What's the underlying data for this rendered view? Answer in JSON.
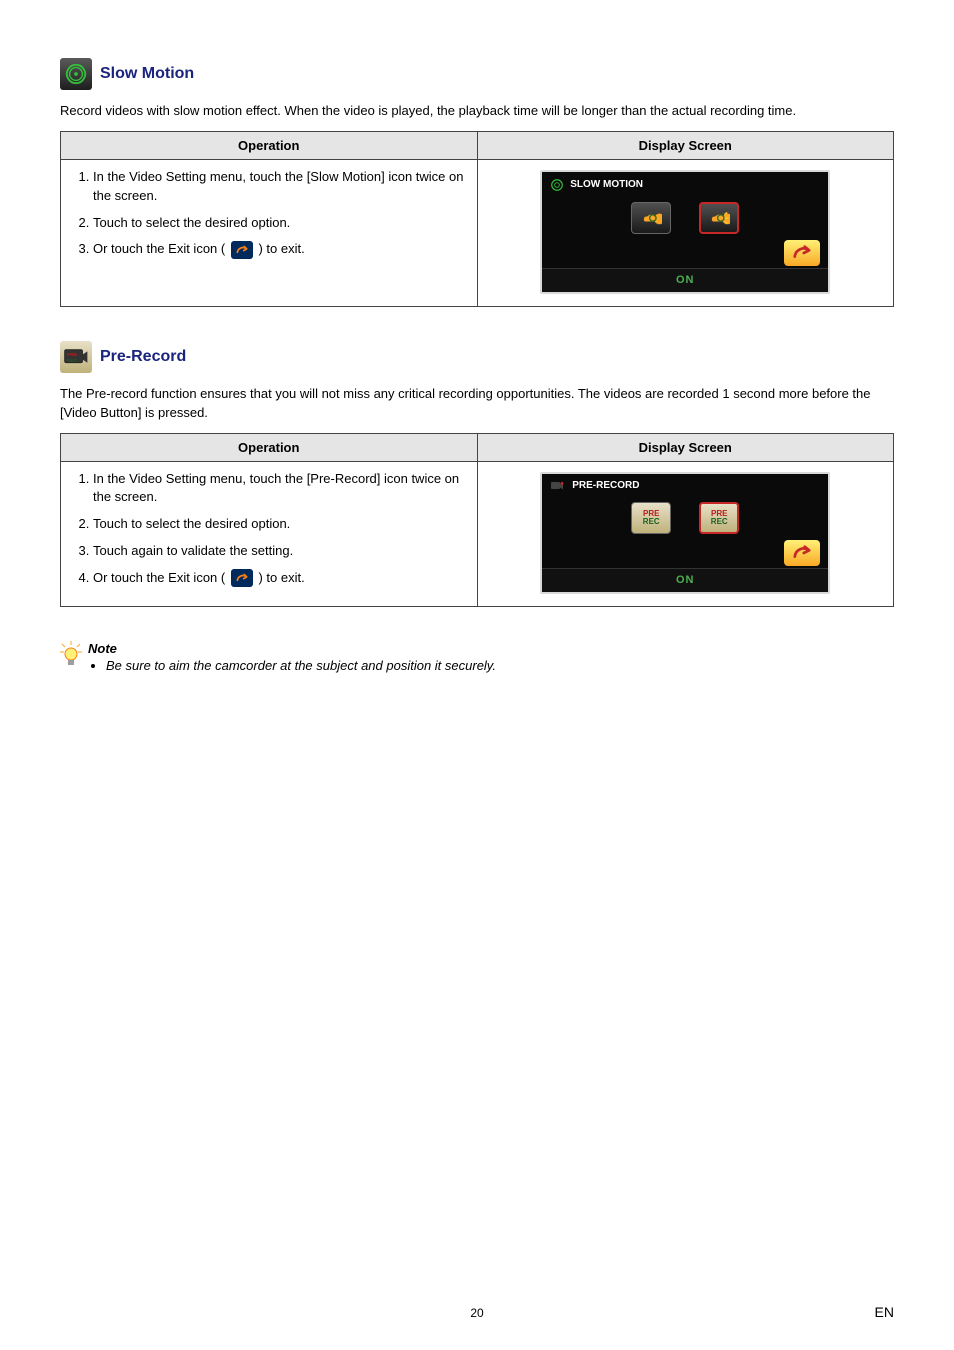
{
  "section1": {
    "title": "Slow Motion",
    "intro": "Record videos with slow motion effect. When the video is played, the playback time will be longer than the actual recording time.",
    "op_header": "Operation",
    "ds_header": "Display Screen",
    "step1": "In the Video Setting menu, touch the [Slow Motion] icon twice on the screen.",
    "step2": "Touch to select the desired option.",
    "step3_a": "Or touch the Exit icon (",
    "step3_b": ") to exit.",
    "screen_title": "SLOW MOTION",
    "screen_status": "ON"
  },
  "section2": {
    "title": "Pre-Record",
    "intro": "The Pre-record function ensures that you will not miss any critical recording opportunities. The videos are recorded 1 second more before the [Video Button] is pressed.",
    "op_header": "Operation",
    "ds_header": "Display Screen",
    "step1": "In the Video Setting menu, touch the [Pre-Record] icon twice on the screen.",
    "step2": "Touch to select the desired option.",
    "step3": "Touch again to validate the setting.",
    "step4_a": "Or touch the Exit icon (",
    "step4_b": ") to exit.",
    "screen_title": "PRE-RECORD",
    "tile_label1": "PRE",
    "tile_label1b": "REC",
    "tile_label2": "PRE",
    "tile_label2b": "REC",
    "screen_status": "ON"
  },
  "note": {
    "title": "Note",
    "item1": "Be sure to aim the camcorder at the subject and position it securely."
  },
  "footer": {
    "page": "20",
    "lang": "EN"
  }
}
